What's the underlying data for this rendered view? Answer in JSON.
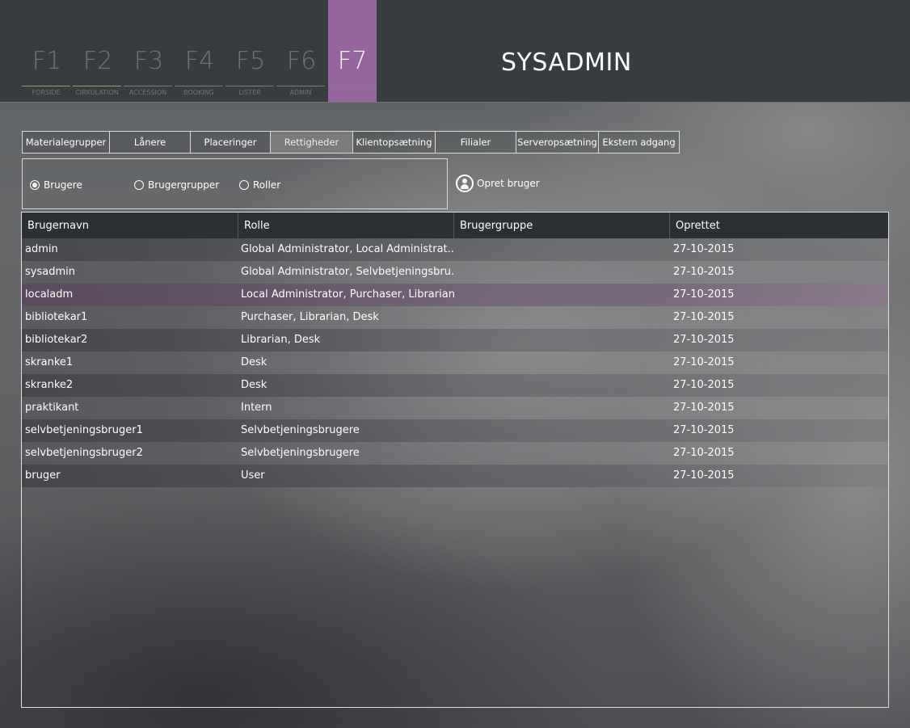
{
  "fkeys": [
    {
      "key": "F1",
      "label": "FORSIDE"
    },
    {
      "key": "F2",
      "label": "CIRKULATION"
    },
    {
      "key": "F3",
      "label": "ACCESSION"
    },
    {
      "key": "F4",
      "label": "BOOKING"
    },
    {
      "key": "F5",
      "label": "LISTER"
    },
    {
      "key": "F6",
      "label": "ADMIN"
    },
    {
      "key": "F7",
      "label": ""
    }
  ],
  "app_title": "SYSADMIN",
  "accent_color": "#96649e",
  "tabs": [
    "Materialegrupper",
    "Lånere",
    "Placeringer",
    "Rettigheder",
    "Klientopsætning",
    "Filialer",
    "Serveropsætning",
    "Ekstern adgang"
  ],
  "active_tab": "Rettigheder",
  "radios": {
    "brugere": "Brugere",
    "brugergrupper": "Brugergrupper",
    "roller": "Roller",
    "selected": "Brugere"
  },
  "create_user_label": "Opret bruger",
  "table": {
    "columns": [
      "Brugernavn",
      "Rolle",
      "Brugergruppe",
      "Oprettet"
    ],
    "rows": [
      [
        "admin",
        "Global Administrator, Local Administrat...",
        "",
        "27-10-2015"
      ],
      [
        "sysadmin",
        "Global Administrator, Selvbetjeningsbru...",
        "",
        "27-10-2015"
      ],
      [
        "localadm",
        "Local Administrator, Purchaser, Librarian...",
        "",
        "27-10-2015"
      ],
      [
        "bibliotekar1",
        "Purchaser, Librarian, Desk",
        "",
        "27-10-2015"
      ],
      [
        "bibliotekar2",
        "Librarian, Desk",
        "",
        "27-10-2015"
      ],
      [
        "skranke1",
        "Desk",
        "",
        "27-10-2015"
      ],
      [
        "skranke2",
        "Desk",
        "",
        "27-10-2015"
      ],
      [
        "praktikant",
        "Intern",
        "",
        "27-10-2015"
      ],
      [
        "selvbetjeningsbruger1",
        "Selvbetjeningsbrugere",
        "",
        "27-10-2015"
      ],
      [
        "selvbetjeningsbruger2",
        "Selvbetjeningsbrugere",
        "",
        "27-10-2015"
      ],
      [
        "bruger",
        "User",
        "",
        "27-10-2015"
      ]
    ],
    "selected_row": "localadm"
  }
}
